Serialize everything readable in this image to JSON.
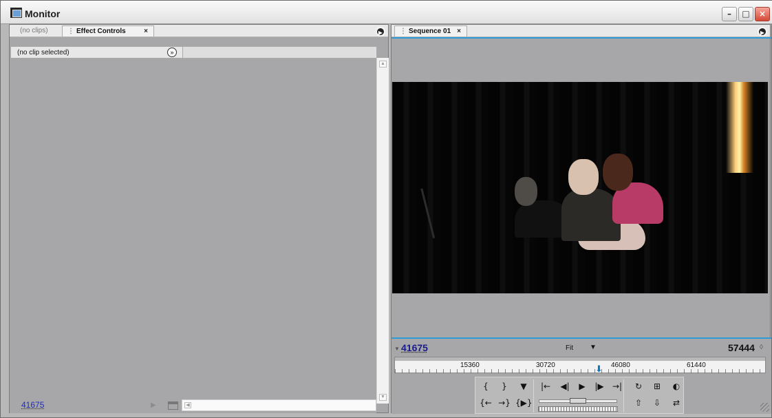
{
  "window": {
    "title": "Monitor"
  },
  "left_panel": {
    "tabs": [
      "(no clips)",
      "Effect Controls"
    ],
    "clip_status": "(no clip selected)",
    "timecode": "41675"
  },
  "right_panel": {
    "tabs": [
      "Sequence 01"
    ],
    "current_timecode": "41675",
    "fit_label": "Fit",
    "duration_timecode": "57444",
    "ruler_labels": [
      "15360",
      "30720",
      "46080",
      "61440"
    ]
  },
  "icons": {
    "minimize": "minimize-icon",
    "maximize": "maximize-icon",
    "close": "close-icon",
    "panel_menu": "panel-menu-icon",
    "play": "play-icon",
    "export": "export-icon"
  },
  "colors": {
    "accent": "#2d9bd7",
    "timecode": "#1a1a8c",
    "close_button": "#d34a36"
  }
}
